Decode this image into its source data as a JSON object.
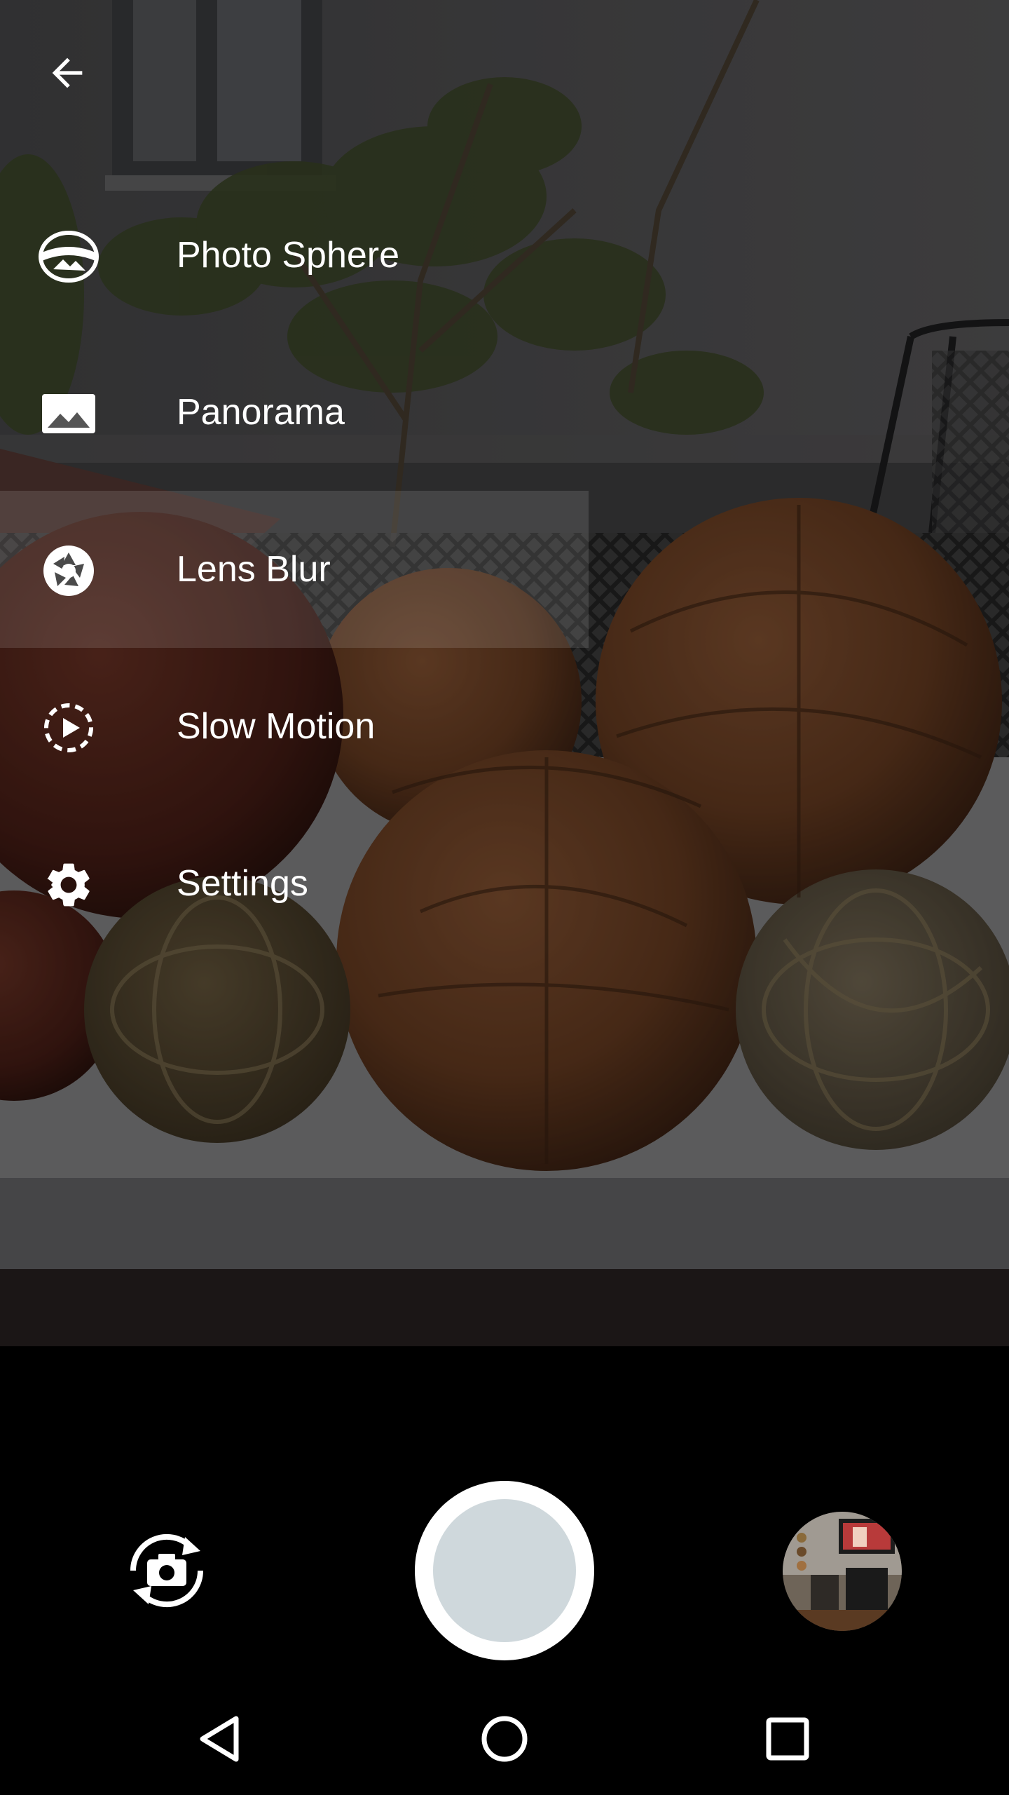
{
  "menu": {
    "back_icon": "arrow-back-icon",
    "items": [
      {
        "label": "Photo Sphere",
        "icon": "photo-sphere-icon",
        "selected": false
      },
      {
        "label": "Panorama",
        "icon": "panorama-icon",
        "selected": false
      },
      {
        "label": "Lens Blur",
        "icon": "lens-blur-icon",
        "selected": true
      },
      {
        "label": "Slow Motion",
        "icon": "slow-motion-icon",
        "selected": false
      },
      {
        "label": "Settings",
        "icon": "gear-icon",
        "selected": false
      }
    ]
  },
  "controls": {
    "switch_camera_icon": "switch-camera-icon",
    "shutter_icon": "shutter-button",
    "thumbnail_icon": "gallery-thumbnail"
  },
  "navbar": {
    "back_icon": "nav-back-icon",
    "home_icon": "nav-home-icon",
    "recents_icon": "nav-recents-icon"
  },
  "colors": {
    "menu_text": "#ffffff",
    "shutter_outer": "#ffffff",
    "shutter_inner": "#cfd8dc",
    "background": "#000000"
  }
}
